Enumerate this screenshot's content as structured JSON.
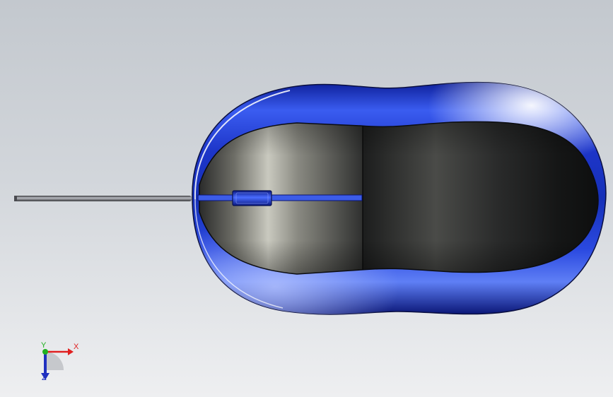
{
  "viewport": {
    "background_top": "#c3c8ce",
    "background_bottom": "#eeeff1"
  },
  "model": {
    "shell_color": "#1f3ad0",
    "shell_highlight": "#7f9cff",
    "button_color": "#2a2b2c",
    "cable_color": "#6f7176",
    "scroll_wheel_color": "#2848e0"
  },
  "triad": {
    "x_label": "X",
    "y_label": "Y",
    "z_label": "Z",
    "x_color": "#e02020",
    "y_color": "#20b020",
    "z_color": "#2030c0"
  }
}
